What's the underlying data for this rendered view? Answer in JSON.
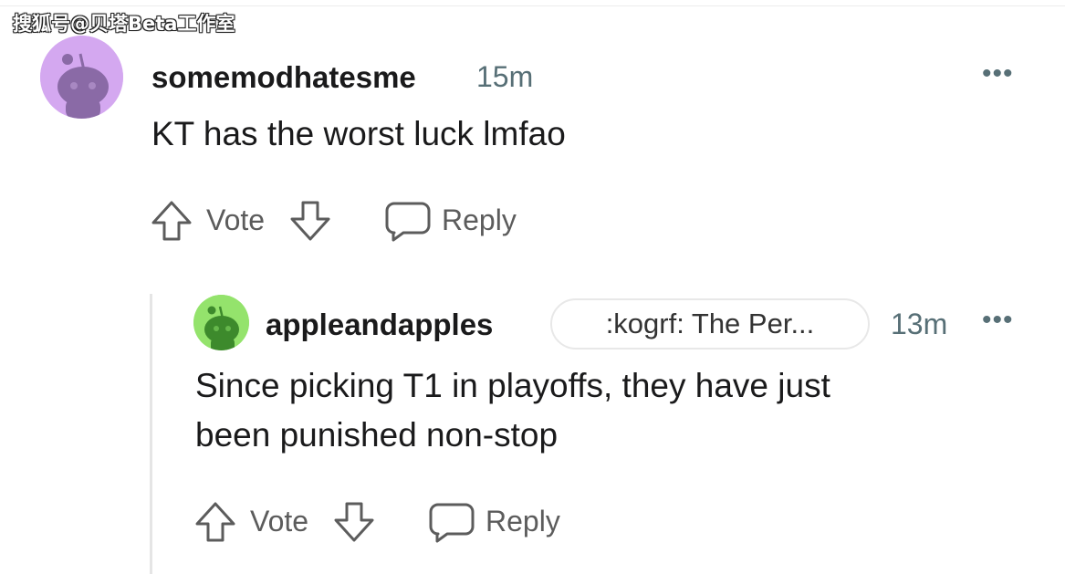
{
  "watermark": "搜狐号@贝塔Beta工作室",
  "comments": [
    {
      "username": "somemodhatesme",
      "time": "15m",
      "more": "•••",
      "text": "KT has the worst luck lmfao",
      "vote_label": "Vote",
      "reply_label": "Reply",
      "avatar_color": "#d4a8f0",
      "avatar_snoo_color": "#8a6aa6"
    },
    {
      "username": "appleandapples",
      "flair": ":kogrf: The Per...",
      "time": "13m",
      "more": "•••",
      "text_line1": "Since picking T1 in playoffs, they have just",
      "text_line2": "been punished non-stop",
      "vote_label": "Vote",
      "reply_label": "Reply",
      "avatar_color": "#94e36c",
      "avatar_snoo_color": "#3d8a2c"
    }
  ]
}
